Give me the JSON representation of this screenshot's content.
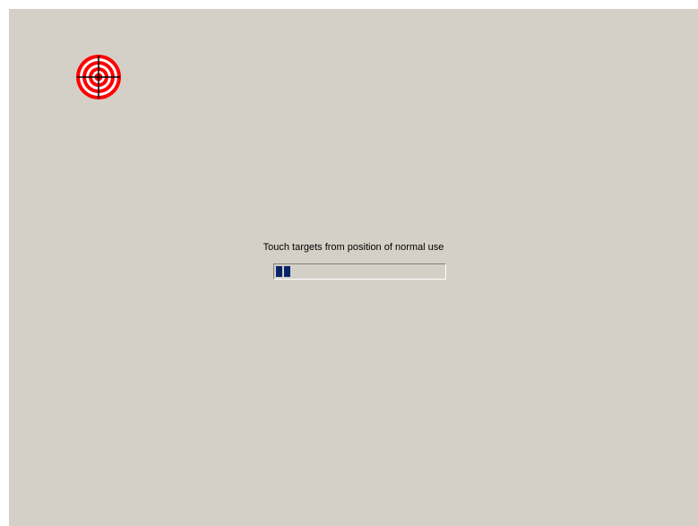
{
  "calibration": {
    "instruction": "Touch targets from position of normal use",
    "progress_percent": 10,
    "progress_blocks_filled": 2
  },
  "target": {
    "icon": "crosshair-target-icon"
  },
  "colors": {
    "background": "#d4d0c8",
    "target_red": "#ff0000",
    "progress_fill": "#0a246a"
  }
}
